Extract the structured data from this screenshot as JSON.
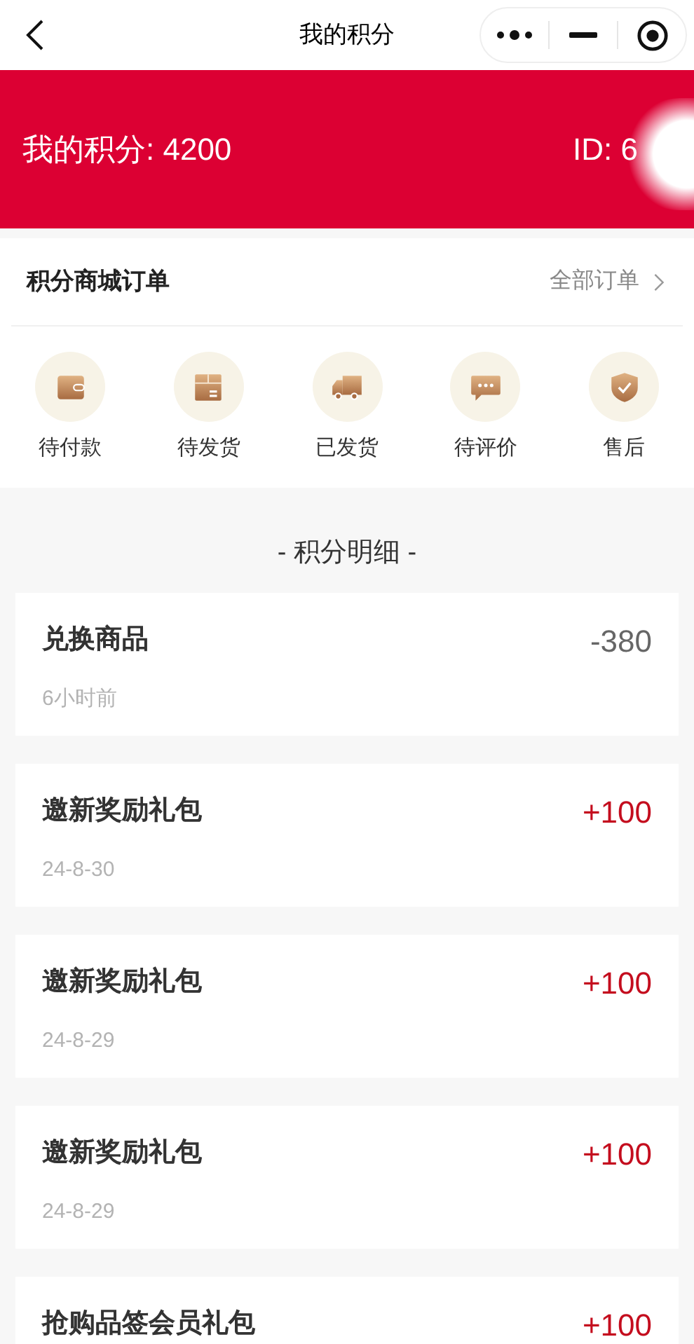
{
  "nav": {
    "title": "我的积分"
  },
  "banner": {
    "points": "我的积分: 4200",
    "id": "ID: 6"
  },
  "orders": {
    "title": "积分商城订单",
    "all_link": "全部订单",
    "items": [
      {
        "kind": "wallet",
        "label": "待付款"
      },
      {
        "kind": "box",
        "label": "待发货"
      },
      {
        "kind": "truck",
        "label": "已发货"
      },
      {
        "kind": "chat",
        "label": "待评价"
      },
      {
        "kind": "shield",
        "label": "售后"
      }
    ]
  },
  "details": {
    "title": "- 积分明细 -",
    "records": [
      {
        "name": "兑换商品",
        "time": "6小时前",
        "amount": "-380",
        "kind": "spend"
      },
      {
        "name": "邀新奖励礼包",
        "time": "24-8-30",
        "amount": "+100",
        "kind": "earn"
      },
      {
        "name": "邀新奖励礼包",
        "time": "24-8-29",
        "amount": "+100",
        "kind": "earn"
      },
      {
        "name": "邀新奖励礼包",
        "time": "24-8-29",
        "amount": "+100",
        "kind": "earn"
      },
      {
        "name": "抢购品签会员礼包",
        "amount": "+100",
        "kind": "earn"
      }
    ]
  }
}
